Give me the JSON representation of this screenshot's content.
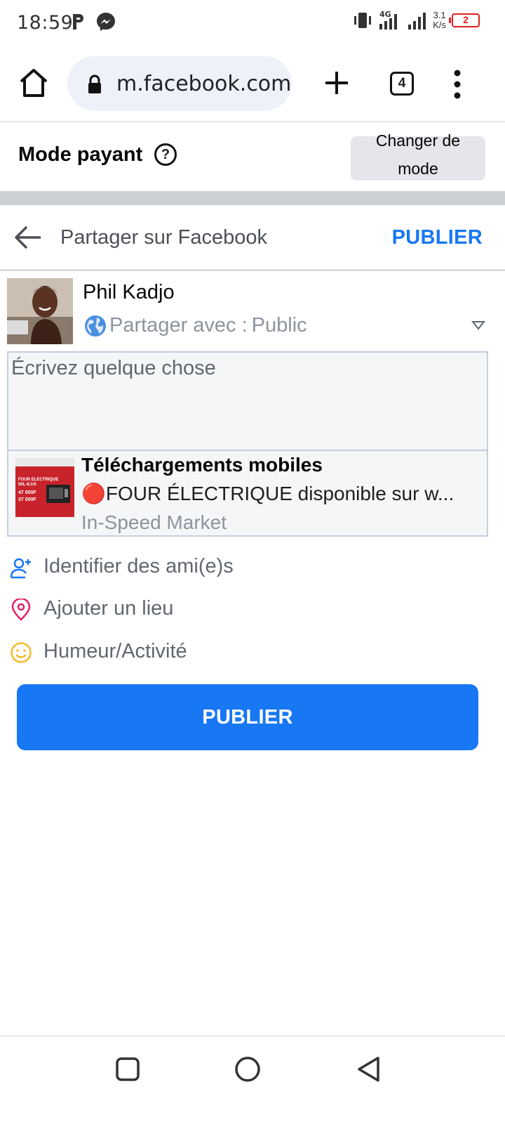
{
  "status": {
    "time": "18:59",
    "net_speed_value": "3.1",
    "net_speed_unit": "K/s",
    "battery": "2",
    "network": "4G"
  },
  "browser": {
    "url": "m.facebook.com",
    "tab_count": "4"
  },
  "mode_bar": {
    "title": "Mode payant",
    "help_glyph": "?",
    "switch_line1": "Changer de",
    "switch_line2": "mode"
  },
  "share_header": {
    "title": "Partager sur Facebook",
    "publish_label": "PUBLIER"
  },
  "user": {
    "name": "Phil Kadjo",
    "audience_label": "Partager avec :",
    "audience_value": "Public"
  },
  "composer": {
    "placeholder": "Écrivez quelque chose"
  },
  "attachment": {
    "title": "Téléchargements mobiles",
    "description": "🔴FOUR ÉLECTRIQUE disponible sur w...",
    "source": "In-Speed Market",
    "thumb_text_1": "FOUR ELECTRIQUE",
    "thumb_text_2": "50L-ILUX",
    "thumb_price_1": "47 000F",
    "thumb_price_2": "37 000F"
  },
  "options": [
    {
      "label": "Identifier des ami(e)s",
      "icon": "tag-friends-icon",
      "color": "#1877f2"
    },
    {
      "label": "Ajouter un lieu",
      "icon": "location-pin-icon",
      "color": "#e41e68"
    },
    {
      "label": "Humeur/Activité",
      "icon": "smiley-icon",
      "color": "#f7b928"
    }
  ],
  "publish_button": {
    "label": "PUBLIER"
  },
  "colors": {
    "primary": "#1877f2",
    "battery_low": "#e02020"
  }
}
